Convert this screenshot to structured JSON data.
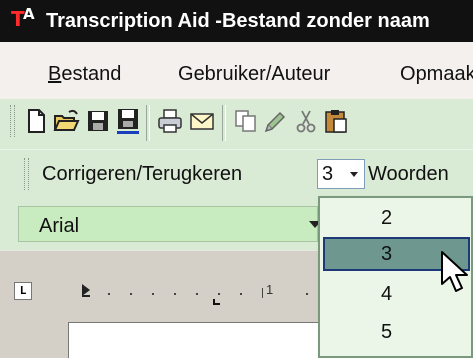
{
  "window": {
    "logo_t": "T",
    "logo_a": "A",
    "title": "Transcription Aid -Bestand zonder naam"
  },
  "menubar": {
    "items": [
      "Bestand",
      "Gebruiker/Auteur",
      "Opmaak"
    ]
  },
  "toolbar": {
    "icons": [
      "new-document-icon",
      "open-folder-icon",
      "save-icon",
      "save-all-icon",
      "print-icon",
      "email-icon",
      "copy-icon",
      "format-painter-icon",
      "cut-icon",
      "paste-icon"
    ]
  },
  "correction_toolbar": {
    "label": "Corrigeren/Terugkeren",
    "steps_value": "3",
    "next_label": "Woorden"
  },
  "font_toolbar": {
    "font_name": "Arial"
  },
  "ruler": {
    "tab_stop_glyph": "L",
    "mark_label": "1"
  },
  "dropdown": {
    "options": [
      "2",
      "3",
      "4",
      "5"
    ],
    "selected": "3"
  },
  "colors": {
    "title_bar": "#111111",
    "toolbar_green": "#d9ead5",
    "selection": "#6e988f",
    "selection_border": "#1c3a78"
  }
}
